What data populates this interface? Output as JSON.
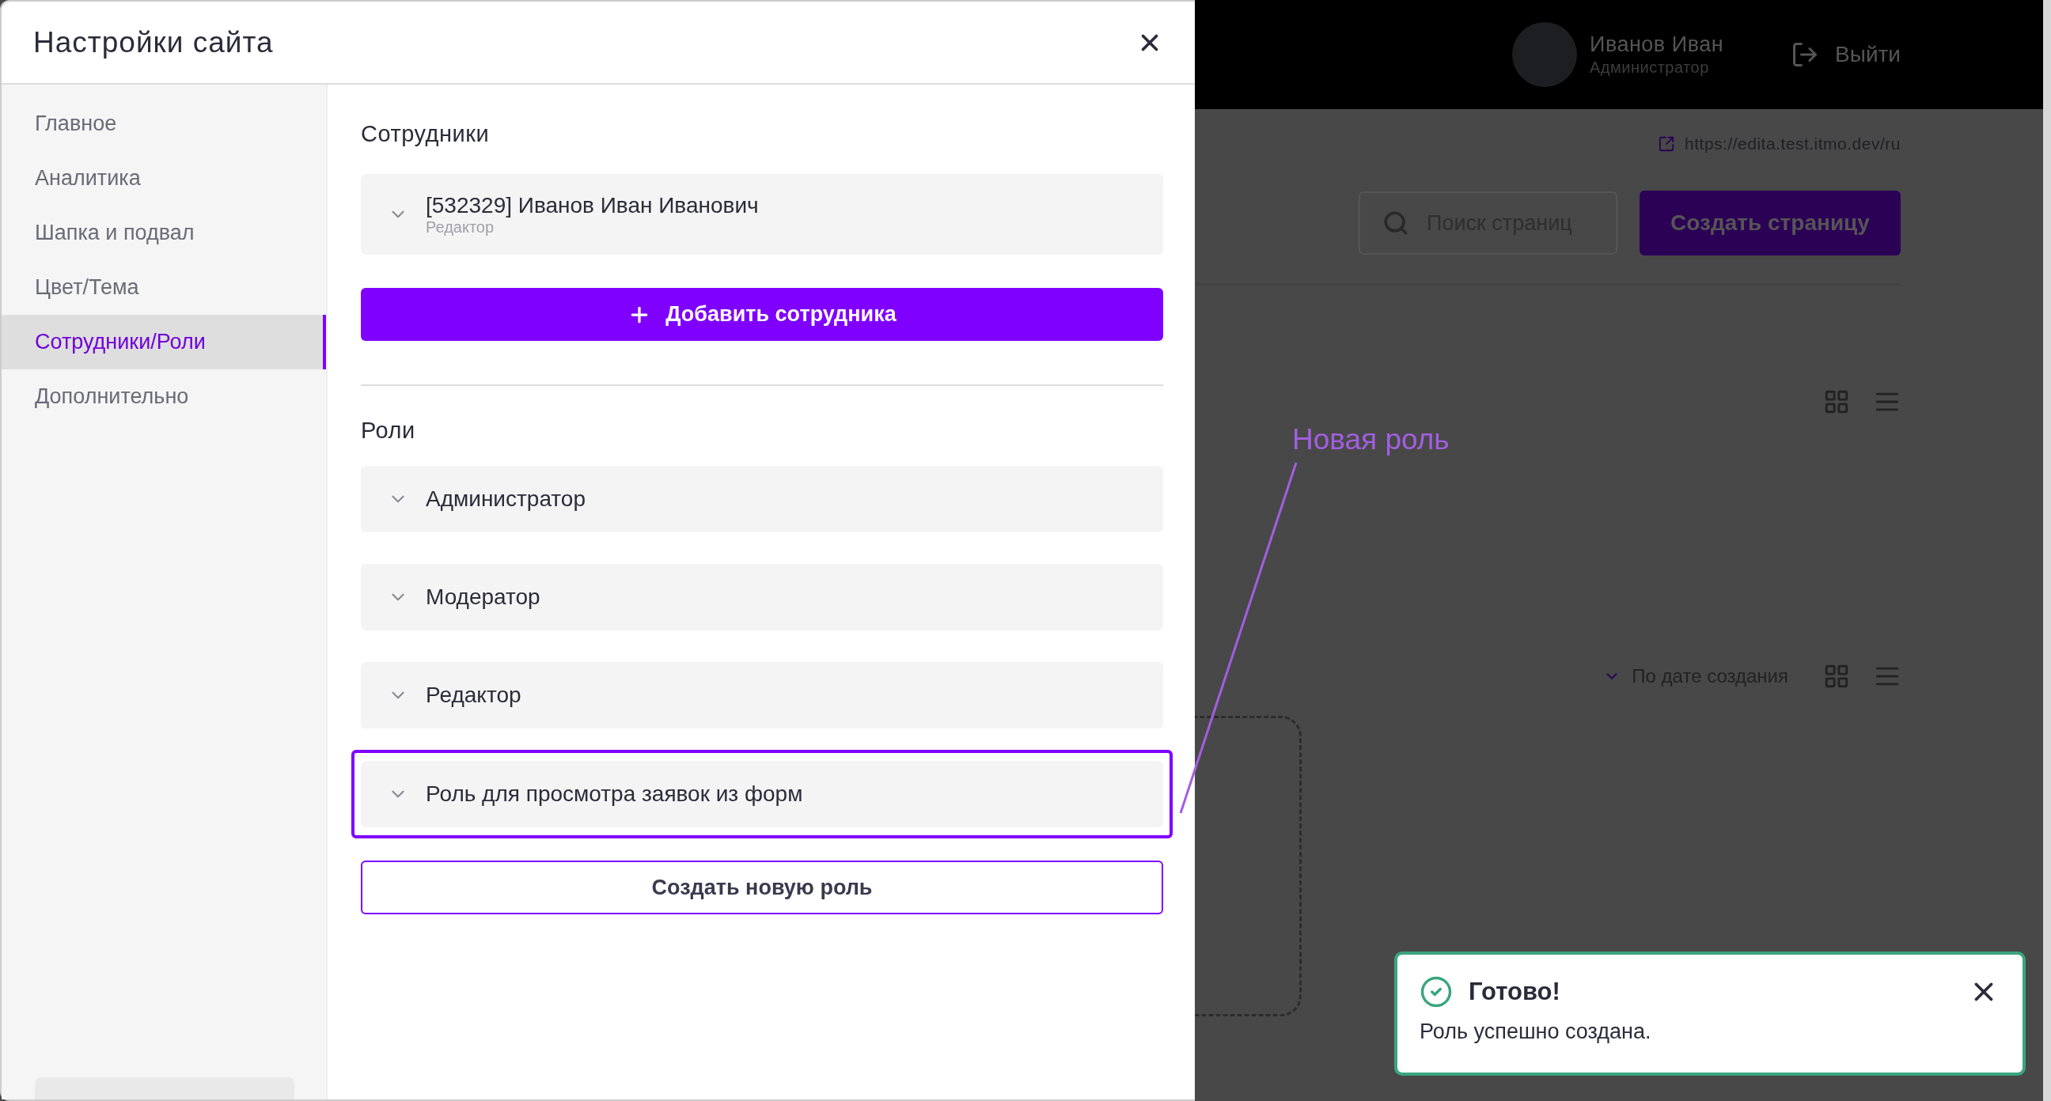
{
  "modal": {
    "title": "Настройки сайта"
  },
  "nav": [
    {
      "label": "Главное",
      "selected": false
    },
    {
      "label": "Аналитика",
      "selected": false
    },
    {
      "label": "Шапка и подвал",
      "selected": false
    },
    {
      "label": "Цвет/Тема",
      "selected": false
    },
    {
      "label": "Сотрудники/Роли",
      "selected": true
    },
    {
      "label": "Дополнительно",
      "selected": false
    }
  ],
  "employees": {
    "heading": "Сотрудники",
    "items": [
      {
        "name": "[532329] Иванов Иван Иванович",
        "role": "Редактор",
        "expanded": false
      }
    ],
    "add_button": "Добавить сотрудника"
  },
  "roles": {
    "heading": "Роли",
    "items": [
      {
        "name": "Администратор",
        "highlighted": false,
        "expanded": false
      },
      {
        "name": "Модератор",
        "highlighted": false,
        "expanded": false
      },
      {
        "name": "Редактор",
        "highlighted": false,
        "expanded": false
      },
      {
        "name": "Роль для просмотра заявок из форм",
        "highlighted": true,
        "expanded": false
      }
    ],
    "create_button": "Создать новую роль"
  },
  "backdrop": {
    "user": {
      "name": "Иванов Иван",
      "role": "Администратор"
    },
    "logout": "Выйти",
    "site_url": "https://edita.test.itmo.dev/ru",
    "search": {
      "placeholder": "Поиск страниц"
    },
    "create_page_button": "Создать страницу",
    "sort_label": "По дате создания"
  },
  "annotation": {
    "text": "Новая роль"
  },
  "toast": {
    "title": "Готово!",
    "message": "Роль успешно создана."
  }
}
